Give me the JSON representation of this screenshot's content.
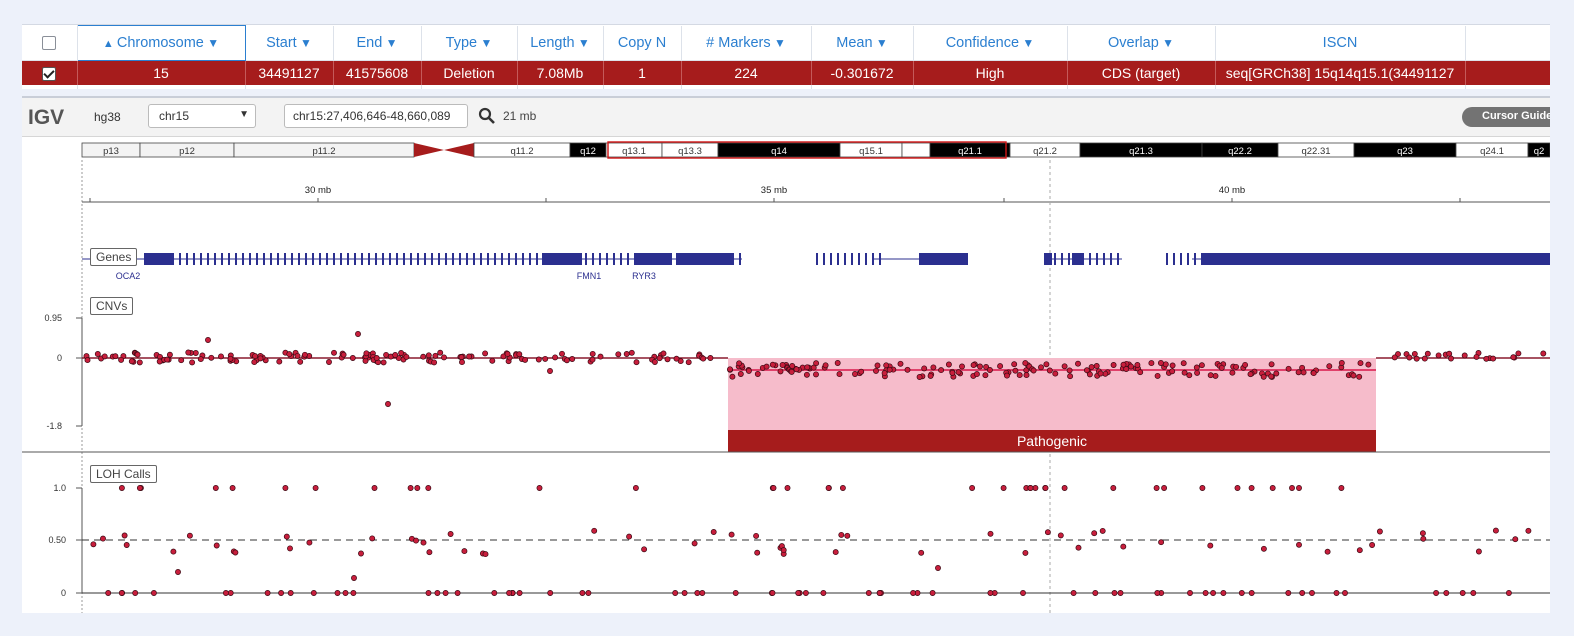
{
  "table": {
    "columns": [
      {
        "key": "select",
        "label": "",
        "filter": false,
        "sort": "",
        "sorted": false
      },
      {
        "key": "chromosome",
        "label": "Chromosome",
        "filter": true,
        "sort": "▲",
        "sorted": true
      },
      {
        "key": "start",
        "label": "Start",
        "filter": true,
        "sort": "",
        "sorted": false
      },
      {
        "key": "end",
        "label": "End",
        "filter": true,
        "sort": "",
        "sorted": false
      },
      {
        "key": "type",
        "label": "Type",
        "filter": true,
        "sort": "",
        "sorted": false
      },
      {
        "key": "length",
        "label": "Length",
        "filter": true,
        "sort": "",
        "sorted": false
      },
      {
        "key": "copy_n",
        "label": "Copy N",
        "filter": false,
        "sort": "",
        "sorted": false
      },
      {
        "key": "markers",
        "label": "# Markers",
        "filter": true,
        "sort": "",
        "sorted": false
      },
      {
        "key": "mean",
        "label": "Mean",
        "filter": true,
        "sort": "",
        "sorted": false
      },
      {
        "key": "confidence",
        "label": "Confidence",
        "filter": true,
        "sort": "",
        "sorted": false
      },
      {
        "key": "overlap",
        "label": "Overlap",
        "filter": true,
        "sort": "",
        "sorted": false
      },
      {
        "key": "iscn",
        "label": "ISCN",
        "filter": false,
        "sort": "",
        "sorted": false
      },
      {
        "key": "extra",
        "label": "",
        "filter": false,
        "sort": "",
        "sorted": false
      }
    ],
    "rows": [
      {
        "selected": true,
        "cells": [
          "15",
          "34491127",
          "41575608",
          "Deletion",
          "7.08Mb",
          "1",
          "224",
          "-0.301672",
          "High",
          "CDS (target)",
          "seq[GRCh38] 15q14q15.1(34491127",
          ""
        ]
      }
    ],
    "filter_icon": "funnel-icon",
    "colors": {
      "selected_row": "#a61c1c",
      "header_text": "#2b7fd0"
    }
  },
  "igv": {
    "logo": "IGV",
    "genome": "hg38",
    "chromosome": "chr15",
    "locus": "chr15:27,406,646-48,660,089",
    "window": "21 mb",
    "cursor_guide": "Cursor Guide",
    "ideogram_bands": [
      {
        "label": "p13",
        "style": "open"
      },
      {
        "label": "p12",
        "style": "open"
      },
      {
        "label": "p11.2",
        "style": "open"
      },
      {
        "label": "",
        "style": "centromere"
      },
      {
        "label": "q11.2",
        "style": "light"
      },
      {
        "label": "q12",
        "style": "dark"
      },
      {
        "label": "q13.1",
        "style": "light"
      },
      {
        "label": "q13.3",
        "style": "light"
      },
      {
        "label": "q14",
        "style": "dark"
      },
      {
        "label": "q15.1",
        "style": "light"
      },
      {
        "label": "",
        "style": "light"
      },
      {
        "label": "q21.1",
        "style": "dark"
      },
      {
        "label": "q21.2",
        "style": "light"
      },
      {
        "label": "q21.3",
        "style": "dark"
      },
      {
        "label": "q22.2",
        "style": "dark"
      },
      {
        "label": "q22.31",
        "style": "light"
      },
      {
        "label": "q23",
        "style": "dark"
      },
      {
        "label": "q24.1",
        "style": "light"
      },
      {
        "label": "q2",
        "style": "dark"
      }
    ],
    "ruler_ticks": [
      "30 mb",
      "35 mb",
      "40 mb"
    ],
    "tracks": {
      "genes": {
        "name": "Genes",
        "gene_labels": [
          "OCA2",
          "FMN1",
          "RYR3"
        ]
      },
      "cnvs": {
        "name": "CNVs",
        "axis": [
          "0.95",
          "0",
          "-1.8"
        ],
        "segment_label": "Pathogenic"
      },
      "loh": {
        "name": "LOH Calls",
        "axis": [
          "1.0",
          "0.50",
          "0"
        ]
      }
    },
    "colors": {
      "gene": "#2b2f8f",
      "point": "#c81e3c",
      "cnv_fill": "#f6bccb",
      "cnv_bar": "#a61c1c",
      "segment_line": "#e0406a"
    }
  }
}
